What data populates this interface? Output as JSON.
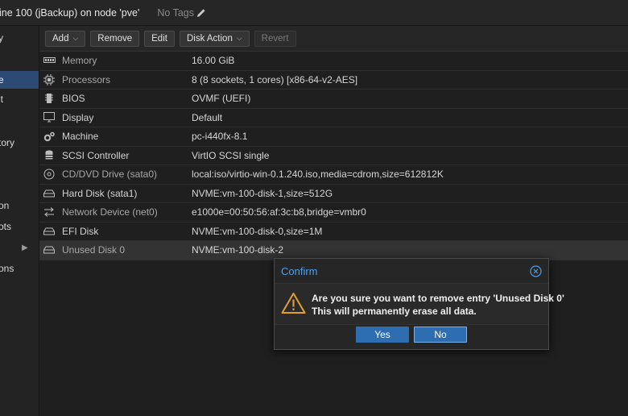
{
  "header": {
    "title": "ine 100 (jBackup) on node 'pve'",
    "tags": "No Tags"
  },
  "nav": {
    "items": [
      {
        "label": "y",
        "active": false
      },
      {
        "label": "e",
        "active": true
      },
      {
        "label": "it",
        "active": false
      },
      {
        "label": "tory",
        "active": false
      },
      {
        "label": "on",
        "active": false
      },
      {
        "label": "ots",
        "active": false
      },
      {
        "label": "ons",
        "active": false
      }
    ]
  },
  "toolbar": {
    "add": "Add",
    "remove": "Remove",
    "edit": "Edit",
    "disk_action": "Disk Action",
    "revert": "Revert"
  },
  "hardware": [
    {
      "icon": "memory-icon",
      "key": "Memory",
      "value": "16.00 GiB"
    },
    {
      "icon": "cpu-icon",
      "key": "Processors",
      "value": "8 (8 sockets, 1 cores) [x86-64-v2-AES]"
    },
    {
      "icon": "chip-icon",
      "key": "BIOS",
      "value": "OVMF (UEFI)"
    },
    {
      "icon": "monitor-icon",
      "key": "Display",
      "value": "Default"
    },
    {
      "icon": "cogs-icon",
      "key": "Machine",
      "value": "pc-i440fx-8.1"
    },
    {
      "icon": "database-icon",
      "key": "SCSI Controller",
      "value": "VirtIO SCSI single"
    },
    {
      "icon": "cdrom-icon",
      "key": "CD/DVD Drive (sata0)",
      "value": "local:iso/virtio-win-0.1.240.iso,media=cdrom,size=612812K"
    },
    {
      "icon": "hdd-icon",
      "key": "Hard Disk (sata1)",
      "value": "NVME:vm-100-disk-1,size=512G"
    },
    {
      "icon": "exchange-icon",
      "key": "Network Device (net0)",
      "value": "e1000e=00:50:56:af:3c:b8,bridge=vmbr0"
    },
    {
      "icon": "hdd-icon",
      "key": "EFI Disk",
      "value": "NVME:vm-100-disk-0,size=1M"
    },
    {
      "icon": "hdd-icon",
      "key": "Unused Disk 0",
      "value": "NVME:vm-100-disk-2"
    }
  ],
  "dialog": {
    "title": "Confirm",
    "message_line1": "Are you sure you want to remove entry 'Unused Disk 0'",
    "message_line2": "This will permanently erase all data.",
    "yes": "Yes",
    "no": "No"
  }
}
